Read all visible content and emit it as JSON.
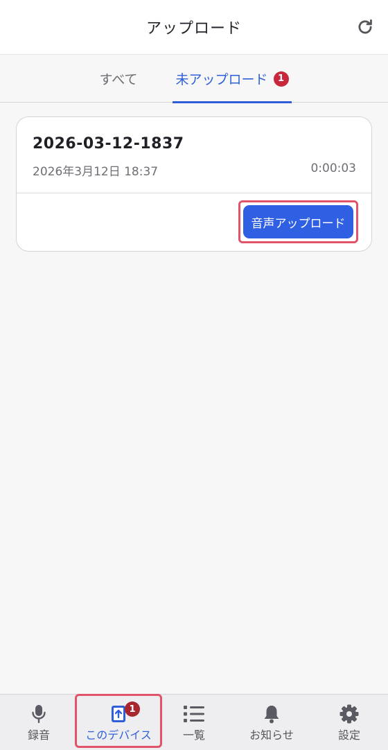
{
  "header": {
    "title": "アップロード",
    "refresh_icon": "refresh-icon"
  },
  "tabs": [
    {
      "label": "すべて",
      "active": false
    },
    {
      "label": "未アップロード",
      "active": true,
      "badge": "1"
    }
  ],
  "recording": {
    "title": "2026-03-12-1837",
    "date": "2026年3月12日 18:37",
    "duration": "0:00:03",
    "upload_label": "音声アップロード"
  },
  "bottom_nav": [
    {
      "label": "録音",
      "icon": "microphone-icon",
      "active": false
    },
    {
      "label": "このデバイス",
      "icon": "upload-device-icon",
      "active": true,
      "badge": "1"
    },
    {
      "label": "一覧",
      "icon": "list-icon",
      "active": false
    },
    {
      "label": "お知らせ",
      "icon": "bell-icon",
      "active": false
    },
    {
      "label": "設定",
      "icon": "gear-icon",
      "active": false
    }
  ],
  "colors": {
    "accent": "#2f5fd8",
    "button": "#2f5fe3",
    "badge": "#c8283b",
    "highlight": "#e2536a"
  }
}
